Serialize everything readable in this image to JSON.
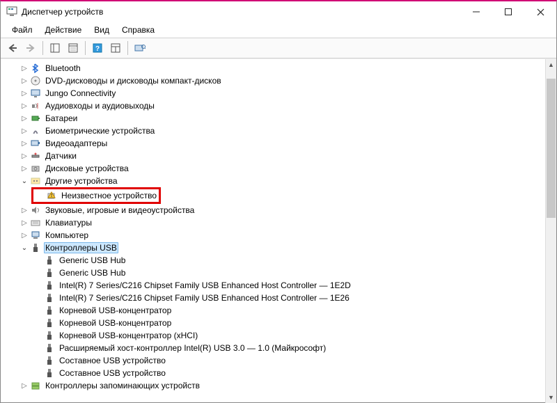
{
  "window": {
    "title": "Диспетчер устройств"
  },
  "menu": {
    "file": "Файл",
    "action": "Действие",
    "view": "Вид",
    "help": "Справка"
  },
  "tree": {
    "bluetooth": "Bluetooth",
    "dvd": "DVD-дисководы и дисководы компакт-дисков",
    "jungo": "Jungo Connectivity",
    "audio_io": "Аудиовходы и аудиовыходы",
    "batteries": "Батареи",
    "biometric": "Биометрические устройства",
    "video_adapters": "Видеоадаптеры",
    "sensors": "Датчики",
    "disk": "Дисковые устройства",
    "other": "Другие устройства",
    "unknown": "Неизвестное устройство",
    "sound": "Звуковые, игровые и видеоустройства",
    "keyboards": "Клавиатуры",
    "computer": "Компьютер",
    "usb_controllers": "Контроллеры USB",
    "usb1": "Generic USB Hub",
    "usb2": "Generic USB Hub",
    "usb3": "Intel(R) 7 Series/C216 Chipset Family USB Enhanced Host Controller — 1E2D",
    "usb4": "Intel(R) 7 Series/C216 Chipset Family USB Enhanced Host Controller — 1E26",
    "usb5": "Корневой USB-концентратор",
    "usb6": "Корневой USB-концентратор",
    "usb7": "Корневой USB-концентратор (xHCI)",
    "usb8": "Расширяемый хост-контроллер Intel(R) USB 3.0 — 1.0 (Майкрософт)",
    "usb9": "Составное USB устройство",
    "usb10": "Составное USB устройство",
    "storage_ctrl": "Контроллеры запоминающих устройств"
  }
}
